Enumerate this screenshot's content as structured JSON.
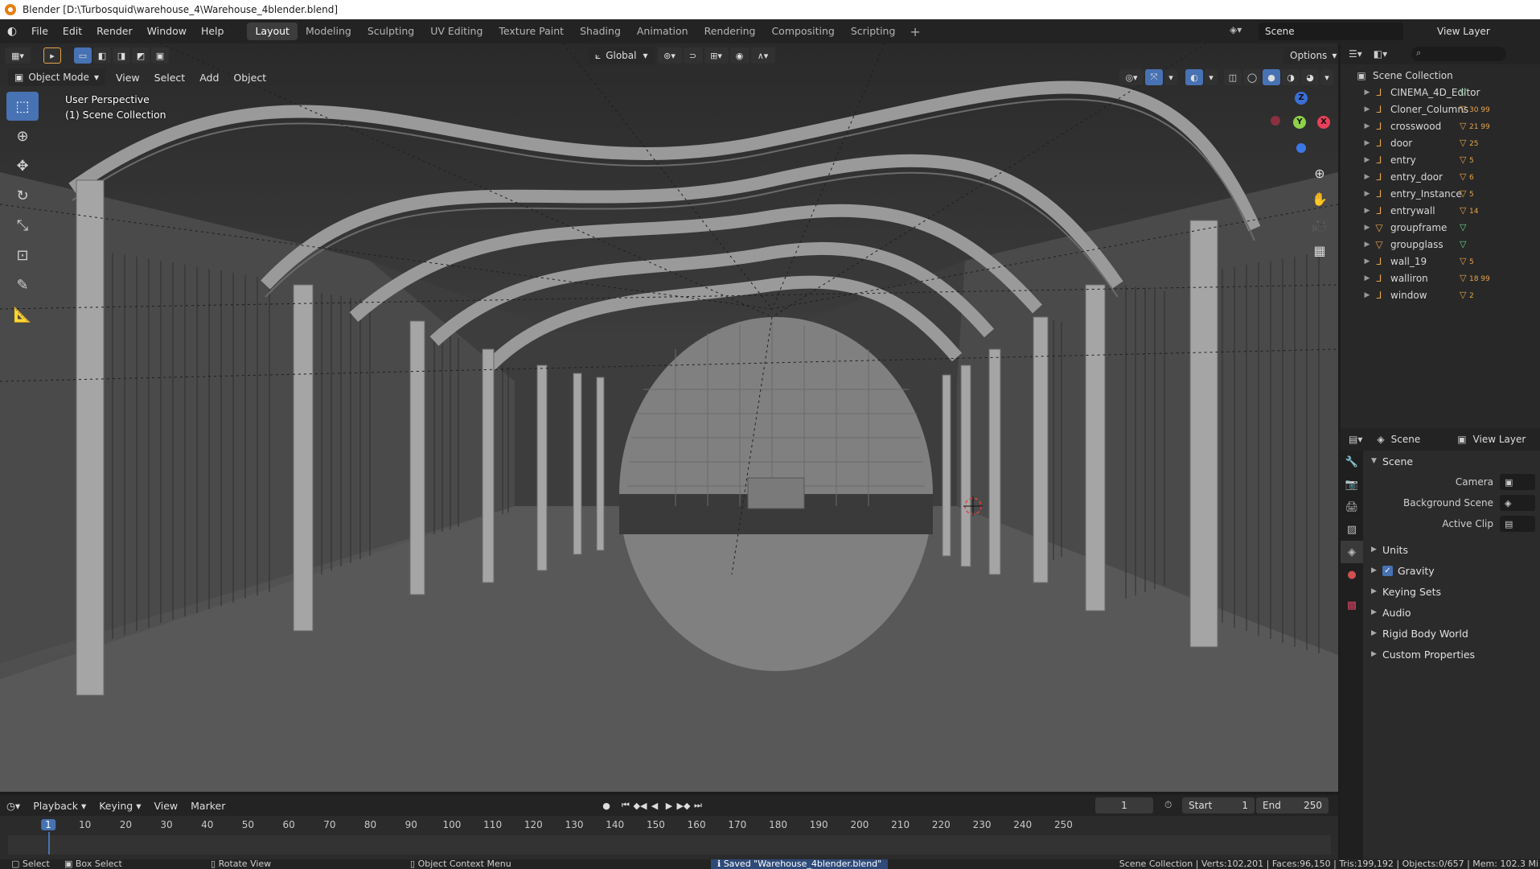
{
  "window": {
    "title": "Blender [D:\\Turbosquid\\warehouse_4\\Warehouse_4blender.blend]"
  },
  "topbar": {
    "menus": [
      "File",
      "Edit",
      "Render",
      "Window",
      "Help"
    ],
    "workspaces": [
      "Layout",
      "Modeling",
      "Sculpting",
      "UV Editing",
      "Texture Paint",
      "Shading",
      "Animation",
      "Rendering",
      "Compositing",
      "Scripting"
    ],
    "active_workspace": "Layout",
    "add_symbol": "+",
    "scene": "Scene",
    "view_layer": "View Layer"
  },
  "viewport": {
    "mode": "Object Mode",
    "menus": [
      "View",
      "Select",
      "Add",
      "Object"
    ],
    "transform_orientation": "Global",
    "options_label": "Options",
    "perspective_label": "User Perspective",
    "collection_label": "(1) Scene Collection",
    "gizmo": {
      "x": "X",
      "y": "Y",
      "z": "Z"
    }
  },
  "outliner": {
    "root": "Scene Collection",
    "items": [
      {
        "name": "CINEMA_4D_Editor",
        "badge": ""
      },
      {
        "name": "Cloner_Columns",
        "badge": "30 99"
      },
      {
        "name": "crosswood",
        "badge": "21 99"
      },
      {
        "name": "door",
        "badge": "25"
      },
      {
        "name": "entry",
        "badge": "5"
      },
      {
        "name": "entry_door",
        "badge": "6"
      },
      {
        "name": "entry_Instance",
        "badge": "5"
      },
      {
        "name": "entrywall",
        "badge": "14"
      },
      {
        "name": "groupframe",
        "badge": ""
      },
      {
        "name": "groupglass",
        "badge": ""
      },
      {
        "name": "wall_19",
        "badge": "5"
      },
      {
        "name": "walliron",
        "badge": "18 99"
      },
      {
        "name": "window",
        "badge": "2"
      }
    ]
  },
  "properties": {
    "header_scene": "Scene",
    "header_view_layer": "View Layer",
    "panel_title": "Scene",
    "fields": [
      "Camera",
      "Background Scene",
      "Active Clip"
    ],
    "panels": [
      "Units",
      "Gravity",
      "Keying Sets",
      "Audio",
      "Rigid Body World",
      "Custom Properties"
    ]
  },
  "timeline": {
    "menus": [
      "Playback",
      "Keying",
      "View",
      "Marker"
    ],
    "current_frame": "1",
    "start_label": "Start",
    "start": "1",
    "end_label": "End",
    "end": "250",
    "ticks": [
      "1",
      "10",
      "20",
      "30",
      "40",
      "50",
      "60",
      "70",
      "80",
      "90",
      "100",
      "110",
      "120",
      "130",
      "140",
      "150",
      "160",
      "170",
      "180",
      "190",
      "200",
      "210",
      "220",
      "230",
      "240",
      "250"
    ]
  },
  "statusbar": {
    "select": "Select",
    "box_select": "Box Select",
    "rotate_view": "Rotate View",
    "context_menu": "Object Context Menu",
    "saved_message": "Saved \"Warehouse_4blender.blend\"",
    "stats": "Scene Collection | Verts:102,201 | Faces:96,150 | Tris:199,192 | Objects:0/657 | Mem: 102.3 Mi"
  }
}
